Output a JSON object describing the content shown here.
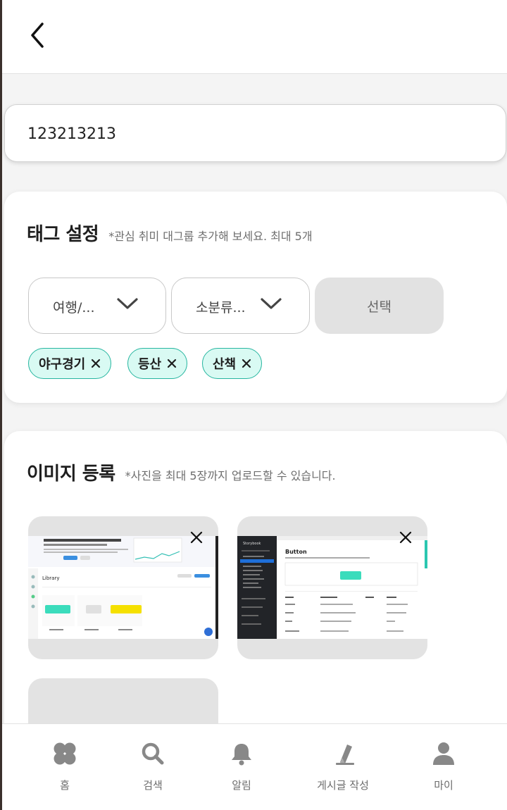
{
  "header": {
    "back_icon": "chevron-left-icon"
  },
  "post": {
    "title_value": "123213213"
  },
  "tags": {
    "title": "태그 설정",
    "hint": "*관심 취미 대그룹 추가해 보세요. 최대 5개",
    "category_select": "여행/...",
    "subcategory_select": "소분류...",
    "select_button": "선택",
    "chips": [
      "야구경기",
      "등산",
      "산책"
    ],
    "chip_color": "#d9faf3",
    "chip_border": "#27b6a0"
  },
  "images": {
    "title": "이미지 등록",
    "hint": "*사진을 최대 5장까지 업로드할 수 있습니다.",
    "thumb1": {
      "banner": "Library",
      "caption": "Storybook",
      "btn_label": "Primary Button"
    },
    "thumb2": {
      "sidebar_title": "Storybook",
      "page_title": "Button",
      "btn_label": "Primary Button"
    }
  },
  "nav": {
    "items": [
      {
        "label": "홈",
        "icon": "home-icon"
      },
      {
        "label": "검색",
        "icon": "search-icon"
      },
      {
        "label": "알림",
        "icon": "bell-icon"
      },
      {
        "label": "게시글 작성",
        "icon": "pencil-icon"
      },
      {
        "label": "마이",
        "icon": "user-icon"
      }
    ]
  }
}
